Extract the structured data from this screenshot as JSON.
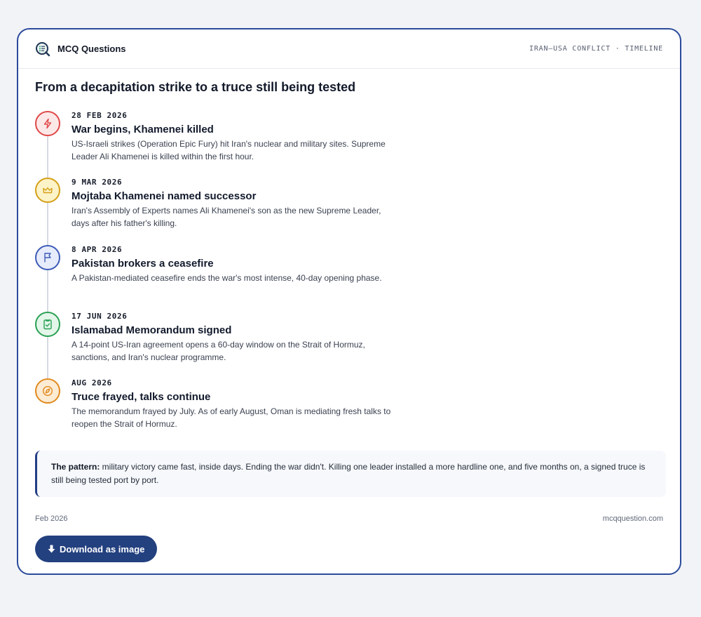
{
  "brand": {
    "name": "MCQ Questions",
    "logo_icon": "magnifier-list-icon"
  },
  "section_label": "IRAN–USA CONFLICT · TIMELINE",
  "headline": "From a decapitation strike to a truce still being tested",
  "events": [
    {
      "date": "28 FEB 2026",
      "title": "War begins, Khamenei killed",
      "desc": "US-Israeli strikes (Operation Epic Fury) hit Iran's nuclear and military sites. Supreme Leader Ali Khamenei is killed within the first hour.",
      "icon": "lightning-icon",
      "color": "#e04848",
      "bg": "#fde8e8"
    },
    {
      "date": "9 MAR 2026",
      "title": "Mojtaba Khamenei named successor",
      "desc": "Iran's Assembly of Experts names Ali Khamenei's son as the new Supreme Leader, days after his father's killing.",
      "icon": "crown-icon",
      "color": "#d4a017",
      "bg": "#fdf3c8"
    },
    {
      "date": "8 APR 2026",
      "title": "Pakistan brokers a ceasefire",
      "desc": "A Pakistan-mediated ceasefire ends the war's most intense, 40-day opening phase.",
      "icon": "flag-icon",
      "color": "#3d5bb8",
      "bg": "#e6ecfb"
    },
    {
      "date": "17 JUN 2026",
      "title": "Islamabad Memorandum signed",
      "desc": "A 14-point US-Iran agreement opens a 60-day window on the Strait of Hormuz, sanctions, and Iran's nuclear programme.",
      "icon": "document-check-icon",
      "color": "#2aa054",
      "bg": "#e3f6e9"
    },
    {
      "date": "AUG 2026",
      "title": "Truce frayed, talks continue",
      "desc": "The memorandum frayed by July. As of early August, Oman is mediating fresh talks to reopen the Strait of Hormuz.",
      "icon": "compass-icon",
      "color": "#e08a1e",
      "bg": "#fdebd3"
    }
  ],
  "pattern": {
    "label": "The pattern:",
    "text": " military victory came fast, inside days. Ending the war didn't. Killing one leader installed a more hardline one, and five months on, a signed truce is still being tested port by port."
  },
  "footer": {
    "date": "Feb 2026",
    "site": "mcqquestion.com"
  },
  "download_button": {
    "label": "Download as image",
    "icon": "download-arrow-icon"
  }
}
